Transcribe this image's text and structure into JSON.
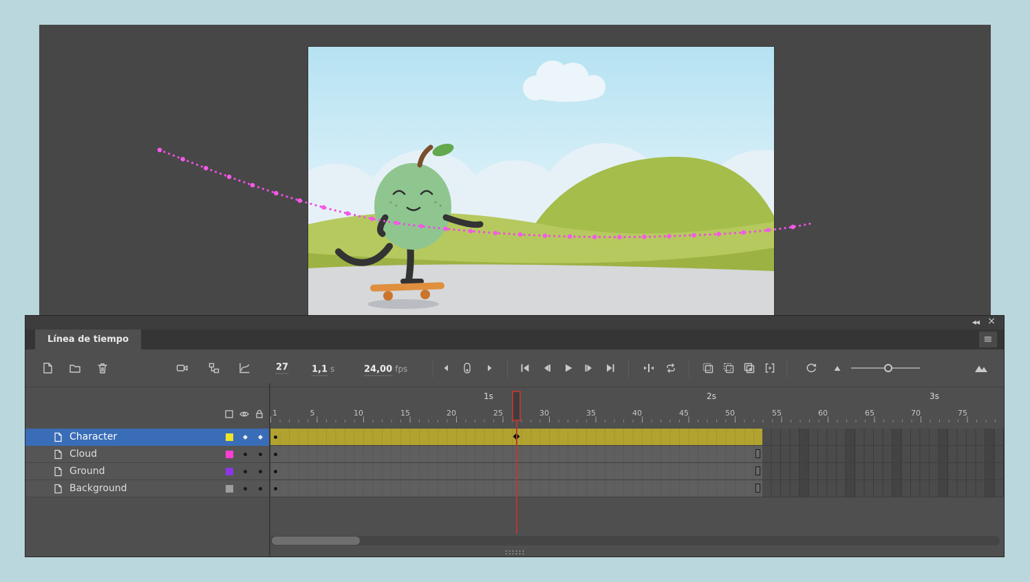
{
  "window": {
    "collapse_icon": "◀◀",
    "close_icon": "×",
    "menu_icon": "≡"
  },
  "panel": {
    "tab_label": "Línea de tiempo"
  },
  "toolbar": {
    "current_frame": "27",
    "time_value": "1,1",
    "time_unit": "s",
    "fps_value": "24,00",
    "fps_unit": "fps"
  },
  "ruler": {
    "seconds": [
      "1s",
      "2s",
      "3s"
    ],
    "frames": [
      "1",
      "5",
      "10",
      "15",
      "20",
      "25",
      "30",
      "35",
      "40",
      "45",
      "50",
      "55",
      "60",
      "65",
      "70",
      "75"
    ]
  },
  "layers": [
    {
      "name": "Character",
      "swatch": "#ece32b",
      "selected": true,
      "span": "motion-tween frames 1-53, keyframe at 1, property keyframe at 27"
    },
    {
      "name": "Cloud",
      "swatch": "#ff3fd4",
      "selected": false,
      "span": "static frames 1-53"
    },
    {
      "name": "Ground",
      "swatch": "#8d36e8",
      "selected": false,
      "span": "static frames 1-53"
    },
    {
      "name": "Background",
      "swatch": "#9d9d9d",
      "selected": false,
      "span": "static frames 1-53"
    }
  ],
  "colors": {
    "selected_layer": "#3a6db8",
    "tween_span": "#b2a230",
    "playhead": "#b23a34",
    "motion_path": "#ef4fe3"
  }
}
